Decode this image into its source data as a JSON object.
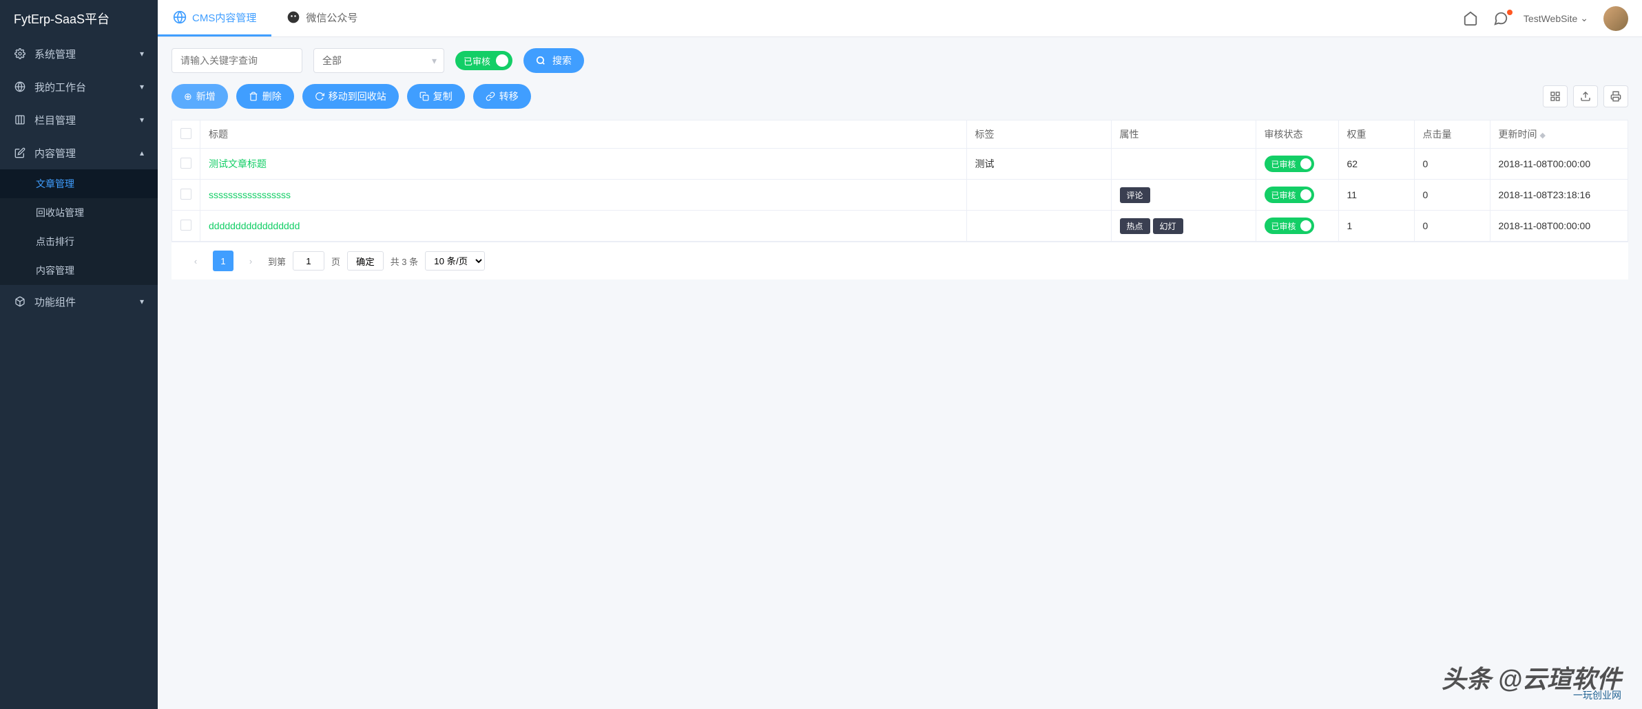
{
  "brand": "FytErp-SaaS平台",
  "sidebar": {
    "items": [
      {
        "label": "系统管理",
        "icon": "gear"
      },
      {
        "label": "我的工作台",
        "icon": "globe"
      },
      {
        "label": "栏目管理",
        "icon": "columns"
      },
      {
        "label": "内容管理",
        "icon": "edit",
        "expanded": true
      },
      {
        "label": "功能组件",
        "icon": "cube"
      }
    ],
    "content_children": [
      {
        "label": "文章管理",
        "active": true
      },
      {
        "label": "回收站管理"
      },
      {
        "label": "点击排行"
      },
      {
        "label": "内容管理"
      }
    ]
  },
  "tabs": [
    {
      "label": "CMS内容管理",
      "icon": "globe",
      "active": true
    },
    {
      "label": "微信公众号",
      "icon": "wechat",
      "active": false
    }
  ],
  "header": {
    "site_name": "TestWebSite"
  },
  "search": {
    "placeholder": "请输入关键字查询",
    "select_value": "全部",
    "switch_label": "已审核",
    "search_btn": "搜索"
  },
  "actions": {
    "add": "新增",
    "delete": "删除",
    "recycle": "移动到回收站",
    "copy": "复制",
    "move": "转移"
  },
  "table": {
    "headers": [
      "标题",
      "标签",
      "属性",
      "审核状态",
      "权重",
      "点击量",
      "更新时间"
    ],
    "rows": [
      {
        "title": "测试文章标题",
        "tag": "测试",
        "attrs": [],
        "status": "已审核",
        "weight": "62",
        "clicks": "0",
        "updated": "2018-11-08T00:00:00"
      },
      {
        "title": "sssssssssssssssss",
        "tag": "",
        "attrs": [
          "评论"
        ],
        "status": "已审核",
        "weight": "11",
        "clicks": "0",
        "updated": "2018-11-08T23:18:16"
      },
      {
        "title": "ddddddddddddddddd",
        "tag": "",
        "attrs": [
          "热点",
          "幻灯"
        ],
        "status": "已审核",
        "weight": "1",
        "clicks": "0",
        "updated": "2018-11-08T00:00:00"
      }
    ]
  },
  "pagination": {
    "current": "1",
    "goto_label": "到第",
    "page_input": "1",
    "page_unit": "页",
    "confirm": "确定",
    "total": "共 3 条",
    "per_page": "10 条/页"
  },
  "watermark": "头条 @云瑄软件",
  "watermark_sub": "一玩创业网"
}
